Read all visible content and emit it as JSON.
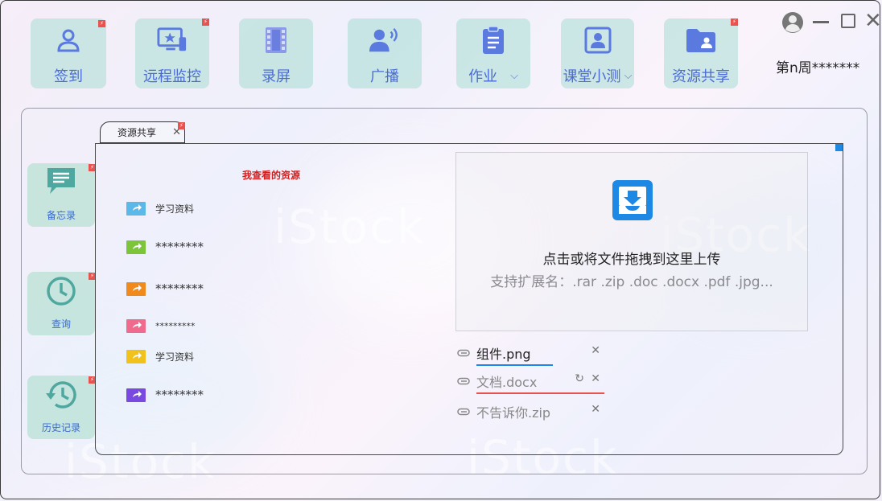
{
  "top_nav": [
    {
      "label": "签到",
      "icon": "user-icon",
      "has_badge": false
    },
    {
      "label": "远程监控",
      "icon": "monitor-icon",
      "has_badge": true
    },
    {
      "label": "录屏",
      "icon": "film-icon",
      "has_badge": false
    },
    {
      "label": "广播",
      "icon": "broadcast-icon",
      "has_badge": false
    },
    {
      "label": "作业",
      "icon": "clipboard-icon",
      "has_badge": false,
      "dropdown": true
    },
    {
      "label": "课堂小测",
      "icon": "portrait-icon",
      "has_badge": false,
      "dropdown": true
    },
    {
      "label": "资源共享",
      "icon": "folder-user-icon",
      "has_badge": true
    }
  ],
  "week_label": "第n周*******",
  "side_nav": [
    {
      "label": "备忘录",
      "icon": "memo-icon"
    },
    {
      "label": "查询",
      "icon": "clock-icon"
    },
    {
      "label": "历史记录",
      "icon": "history-icon"
    }
  ],
  "tab": {
    "label": "资源共享",
    "close": "✕"
  },
  "resources": {
    "title": "我查看的资源",
    "items": [
      {
        "label": "学习资料",
        "color": "#5cb8e8"
      },
      {
        "label": "********",
        "color": "#7cc43a"
      },
      {
        "label": "********",
        "color": "#f08a1c"
      },
      {
        "label": "*********",
        "color": "#f06a8e"
      },
      {
        "label": "学习资料",
        "color": "#f2c21c"
      },
      {
        "label": "********",
        "color": "#7a4ae0"
      }
    ]
  },
  "upload": {
    "main_text": "点击或将文件拖拽到这里上传",
    "sub_text": "支持扩展名：.rar .zip .doc .docx .pdf .jpg..."
  },
  "files": [
    {
      "name": "组件.png",
      "status": "uploading",
      "progress": 0.6
    },
    {
      "name": "文档.docx",
      "status": "error"
    },
    {
      "name": "不告诉你.zip",
      "status": "done"
    }
  ],
  "colors": {
    "accent": "#4a6ad8",
    "nav_bg": "#b0ded6",
    "error": "#e8534f",
    "progress": "#1e88e5"
  }
}
